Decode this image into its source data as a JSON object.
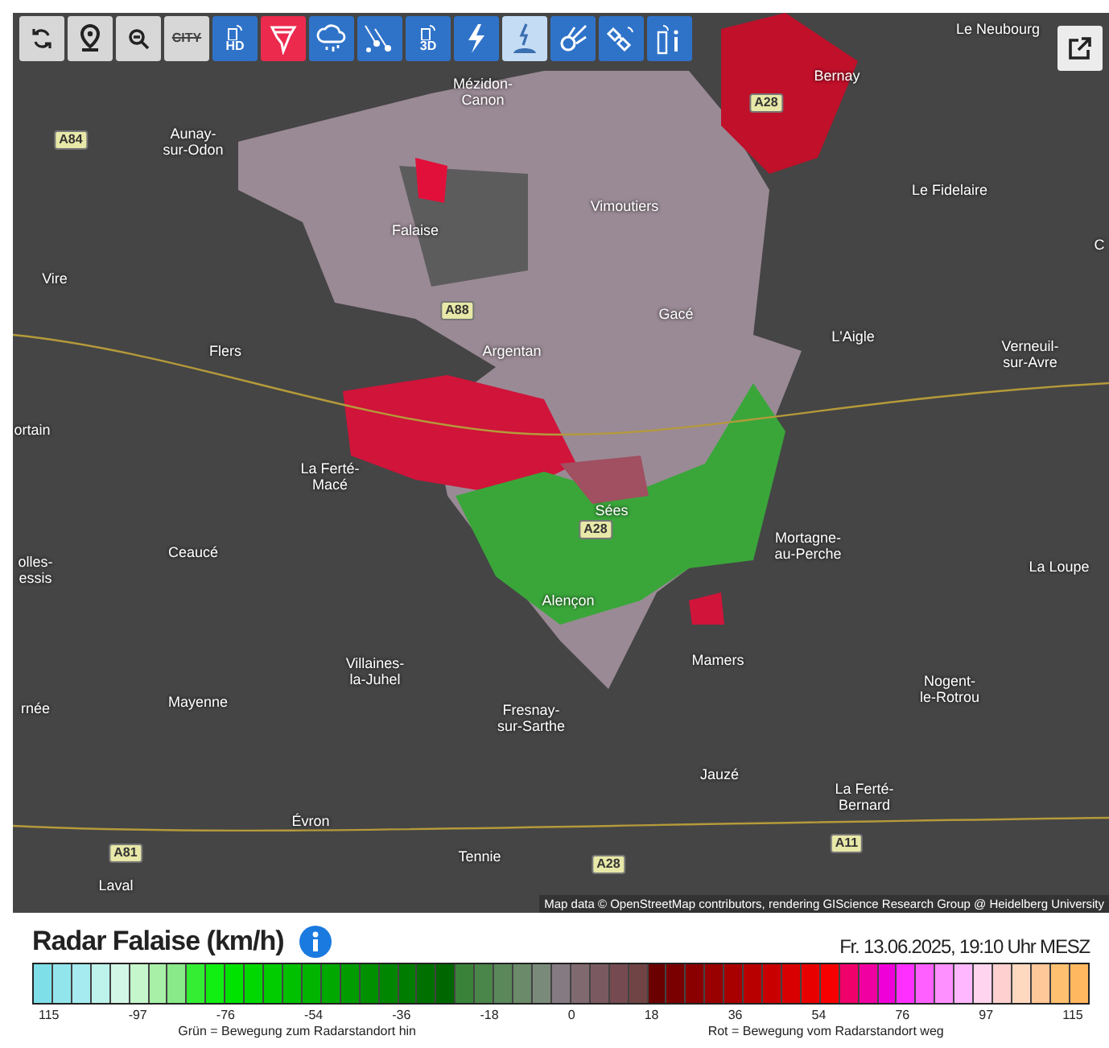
{
  "toolbar": [
    {
      "kind": "refresh",
      "active": false,
      "selected": false
    },
    {
      "kind": "pin",
      "active": false,
      "selected": false
    },
    {
      "kind": "zoom",
      "active": false,
      "selected": false
    },
    {
      "kind": "city",
      "active": false,
      "selected": false,
      "label": "CITY"
    },
    {
      "kind": "radar",
      "active": false,
      "selected": false,
      "label": "HD"
    },
    {
      "kind": "tornado",
      "active": true,
      "selected": false
    },
    {
      "kind": "cloud",
      "active": false,
      "selected": false
    },
    {
      "kind": "hail",
      "active": false,
      "selected": false
    },
    {
      "kind": "radar",
      "active": false,
      "selected": false,
      "label": "3D"
    },
    {
      "kind": "lightning",
      "active": false,
      "selected": false
    },
    {
      "kind": "strike",
      "active": false,
      "selected": true
    },
    {
      "kind": "meteor",
      "active": false,
      "selected": false
    },
    {
      "kind": "satellite",
      "active": false,
      "selected": false
    },
    {
      "kind": "info",
      "active": false,
      "selected": false
    }
  ],
  "map": {
    "labels": [
      {
        "kind": "town",
        "text": "Le Neubourg"
      },
      {
        "kind": "town",
        "text": "Mézidon-\nCanon"
      },
      {
        "kind": "road",
        "text": "A28"
      },
      {
        "kind": "town",
        "text": "Bernay"
      },
      {
        "kind": "road",
        "text": "A84"
      },
      {
        "kind": "town",
        "text": "Aunay-\nsur-Odon"
      },
      {
        "kind": "town",
        "text": "Vimoutiers"
      },
      {
        "kind": "town",
        "text": "Le Fidelaire"
      },
      {
        "kind": "town",
        "text": "Falaise"
      },
      {
        "kind": "town",
        "text": "C"
      },
      {
        "kind": "town",
        "text": "Vire"
      },
      {
        "kind": "road",
        "text": "A88"
      },
      {
        "kind": "town",
        "text": "Gacé"
      },
      {
        "kind": "town",
        "text": "Flers"
      },
      {
        "kind": "town",
        "text": "Argentan"
      },
      {
        "kind": "town",
        "text": "L'Aigle"
      },
      {
        "kind": "town",
        "text": "Verneuil-\nsur-Avre"
      },
      {
        "kind": "town",
        "text": "ortain"
      },
      {
        "kind": "town",
        "text": "La Ferté-\nMacé"
      },
      {
        "kind": "town",
        "text": "Sées"
      },
      {
        "kind": "road",
        "text": "A28"
      },
      {
        "kind": "town",
        "text": "olles-\nessis"
      },
      {
        "kind": "town",
        "text": "Ceaucé"
      },
      {
        "kind": "town",
        "text": "Mortagne-\nau-Perche"
      },
      {
        "kind": "town",
        "text": "La Loupe"
      },
      {
        "kind": "town",
        "text": "Alençon"
      },
      {
        "kind": "town",
        "text": "Villaines-\nla-Juhel"
      },
      {
        "kind": "town",
        "text": "Mamers"
      },
      {
        "kind": "town",
        "text": "rnée"
      },
      {
        "kind": "town",
        "text": "Mayenne"
      },
      {
        "kind": "town",
        "text": "Fresnay-\nsur-Sarthe"
      },
      {
        "kind": "town",
        "text": "Nogent-\nle-Rotrou"
      },
      {
        "kind": "town",
        "text": "Jauzé"
      },
      {
        "kind": "town",
        "text": "La Ferté-\nBernard"
      },
      {
        "kind": "town",
        "text": "Évron"
      },
      {
        "kind": "road",
        "text": "A11"
      },
      {
        "kind": "road",
        "text": "A81"
      },
      {
        "kind": "town",
        "text": "Tennie"
      },
      {
        "kind": "road",
        "text": "A28"
      },
      {
        "kind": "town",
        "text": "Laval"
      }
    ],
    "attribution": "Map data © OpenStreetMap contributors, rendering GIScience Research Group @ Heidelberg University"
  },
  "legend": {
    "title": "Radar Falaise (km/h)",
    "timestamp": "Fr. 13.06.2025, 19:10 Uhr MESZ",
    "cells": [
      {
        "color": "#7fdfe9"
      },
      {
        "color": "#93e5ec"
      },
      {
        "color": "#a6ebef"
      },
      {
        "color": "#bdf3ea"
      },
      {
        "color": "#d2f7e6"
      },
      {
        "color": "#c6f7cc"
      },
      {
        "color": "#a8f0a8"
      },
      {
        "color": "#88ea88"
      },
      {
        "color": "#33ee33"
      },
      {
        "color": "#11ee11"
      },
      {
        "color": "#00e200"
      },
      {
        "color": "#00d800"
      },
      {
        "color": "#00cc00"
      },
      {
        "color": "#00c000"
      },
      {
        "color": "#00b400"
      },
      {
        "color": "#00a800"
      },
      {
        "color": "#009c00"
      },
      {
        "color": "#009000"
      },
      {
        "color": "#008600"
      },
      {
        "color": "#007c00"
      },
      {
        "color": "#007000"
      },
      {
        "color": "#006600"
      },
      {
        "color": "#3a823a"
      },
      {
        "color": "#4a854a"
      },
      {
        "color": "#5a885a"
      },
      {
        "color": "#6a8a6a"
      },
      {
        "color": "#7a8a7a"
      },
      {
        "color": "#857a82"
      },
      {
        "color": "#806a70"
      },
      {
        "color": "#7a5a60"
      },
      {
        "color": "#754a50"
      },
      {
        "color": "#704444"
      },
      {
        "color": "#6a0000"
      },
      {
        "color": "#7a0000"
      },
      {
        "color": "#8a0000"
      },
      {
        "color": "#990000"
      },
      {
        "color": "#a80000"
      },
      {
        "color": "#b80000"
      },
      {
        "color": "#c80000"
      },
      {
        "color": "#d80000"
      },
      {
        "color": "#e80000"
      },
      {
        "color": "#f80000"
      },
      {
        "color": "#f0006a"
      },
      {
        "color": "#f000a0"
      },
      {
        "color": "#f000d8"
      },
      {
        "color": "#ff30ff"
      },
      {
        "color": "#ff60ff"
      },
      {
        "color": "#ff90ff"
      },
      {
        "color": "#ffb8ff"
      },
      {
        "color": "#ffd4ee"
      },
      {
        "color": "#ffd0d0"
      },
      {
        "color": "#ffd8c0"
      },
      {
        "color": "#ffc898"
      },
      {
        "color": "#ffc070"
      },
      {
        "color": "#ffb860"
      }
    ],
    "ticks": [
      "115",
      "-97",
      "-76",
      "-54",
      "-36",
      "-18",
      "0",
      "18",
      "36",
      "54",
      "76",
      "97",
      "115"
    ],
    "notes": [
      "Grün = Bewegung zum Radarstandort hin",
      "Rot = Bewegung vom Radarstandort weg"
    ]
  }
}
